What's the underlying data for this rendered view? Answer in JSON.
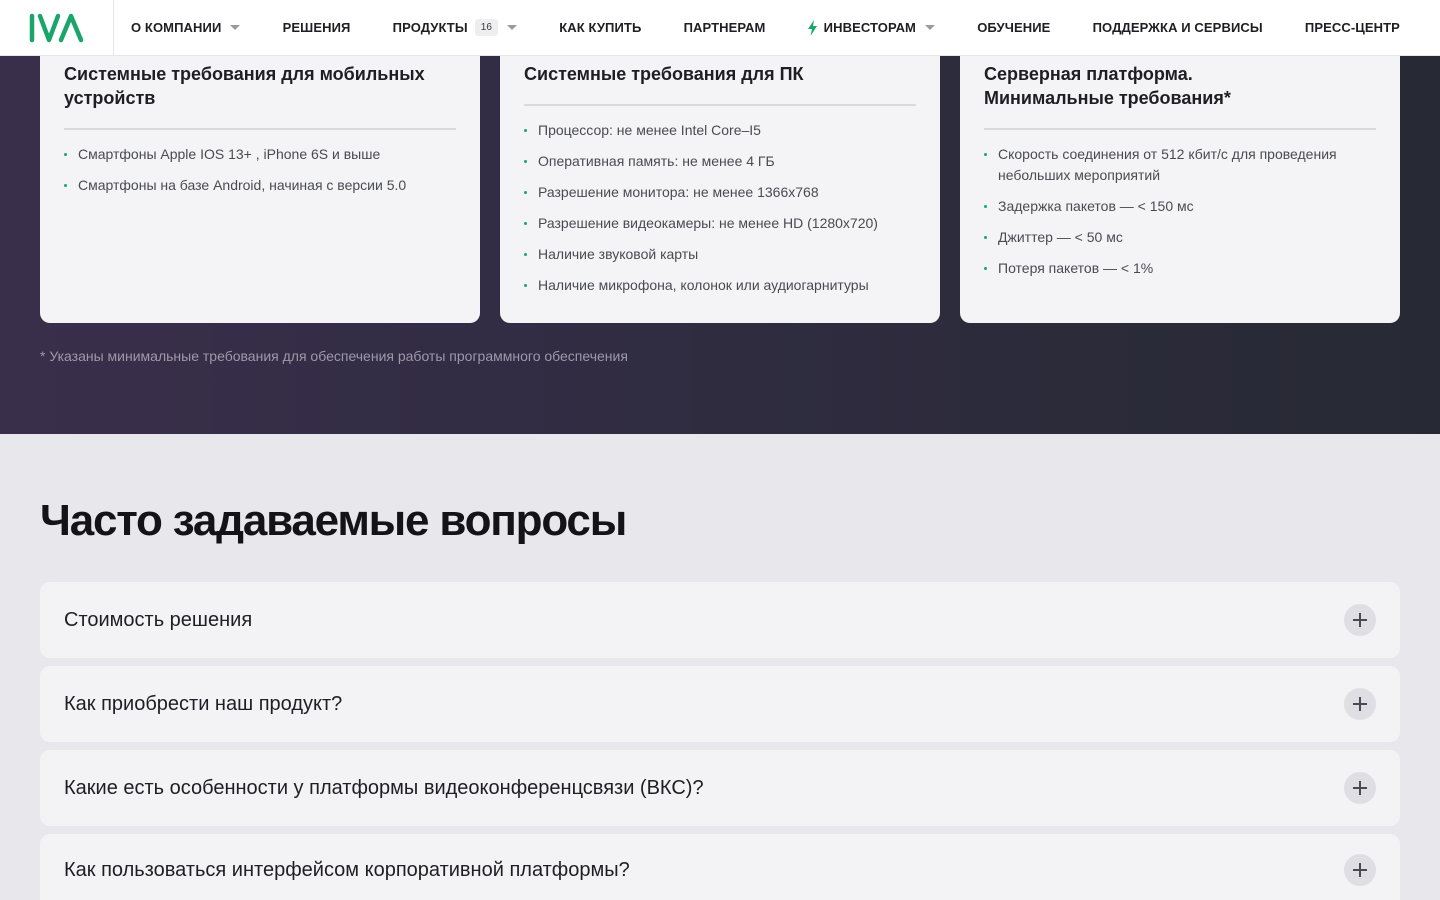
{
  "header": {
    "logo_text": "IVA",
    "brand_color": "#1aa56b",
    "nav": [
      {
        "label": "О КОМПАНИИ"
      },
      {
        "label": "РЕШЕНИЯ"
      },
      {
        "label": "ПРОДУКТЫ",
        "badge": "16"
      },
      {
        "label": "КАК КУПИТЬ"
      },
      {
        "label": "ПАРТНЕРАМ"
      },
      {
        "label": "ИНВЕСТОРАМ"
      },
      {
        "label": "ОБУЧЕНИЕ"
      },
      {
        "label": "ПОДДЕРЖКА И СЕРВИСЫ"
      },
      {
        "label": "ПРЕСС-ЦЕНТР"
      }
    ]
  },
  "requirements": {
    "cards": [
      {
        "title": "Системные требования для мобильных устройств",
        "items": [
          "Смартфоны Apple IOS 13+ , iPhone 6S и выше",
          "Смартфоны на базе Android, начиная с версии 5.0"
        ]
      },
      {
        "title": "Системные требования для ПК",
        "items": [
          "Процессор: не менее Intel Core–I5",
          "Оперативная память: не менее 4 ГБ",
          "Разрешение монитора: не менее 1366x768",
          "Разрешение видеокамеры: не менее HD (1280x720)",
          "Наличие звуковой карты",
          "Наличие микрофона, колонок или аудиогарнитуры"
        ]
      },
      {
        "title": "Серверная платформа. Минимальные требования*",
        "items": [
          "Скорость соединения от 512 кбит/с для проведения небольших мероприятий",
          "Задержка пакетов — < 150 мс",
          "Джиттер — < 50 мс",
          "Потеря пакетов — < 1%"
        ]
      }
    ],
    "footnote": "* Указаны минимальные требования для обеспечения работы программного обеспечения"
  },
  "faq": {
    "title": "Часто задаваемые вопросы",
    "items": [
      {
        "question": "Стоимость решения"
      },
      {
        "question": "Как приобрести наш продукт?"
      },
      {
        "question": "Какие есть особенности у платформы видеоконференцсвязи (ВКС)?"
      },
      {
        "question": "Как пользоваться интерфейсом корпоративной платформы?"
      }
    ]
  }
}
